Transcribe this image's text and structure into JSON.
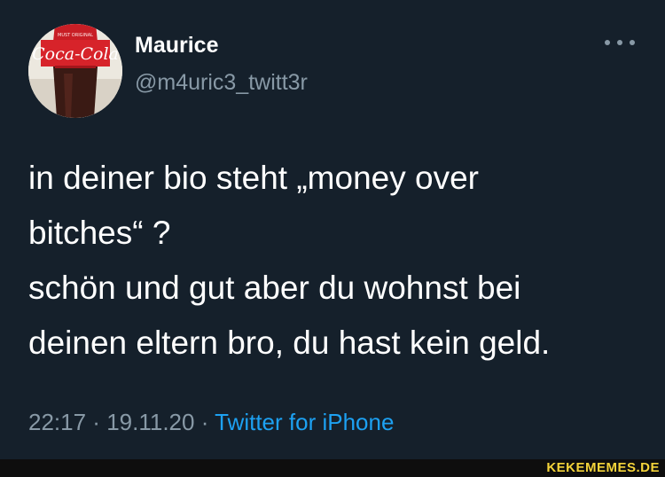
{
  "tweet": {
    "display_name": "Maurice",
    "handle": "@m4uric3_twitt3r",
    "text_lines": [
      "in deiner bio steht „money over",
      "bitches“ ?",
      "schön und gut aber du wohnst bei",
      "deinen eltern bro, du hast kein geld."
    ],
    "time": "22:17",
    "separator": " · ",
    "date": "19.11.20",
    "source": "Twitter for iPhone",
    "more_icon": "more-horizontal-icon"
  },
  "avatar": {
    "icon": "avatar-coca-cola-bottle",
    "brand_text": "Coca-Cola",
    "label_text": "MUST ORIGINAL"
  },
  "watermark": "KEKEMEMES.DE",
  "colors": {
    "background": "#15202b",
    "text": "#ffffff",
    "secondary": "#8899a6",
    "link": "#1da1f2",
    "watermark": "#f5d43a"
  }
}
